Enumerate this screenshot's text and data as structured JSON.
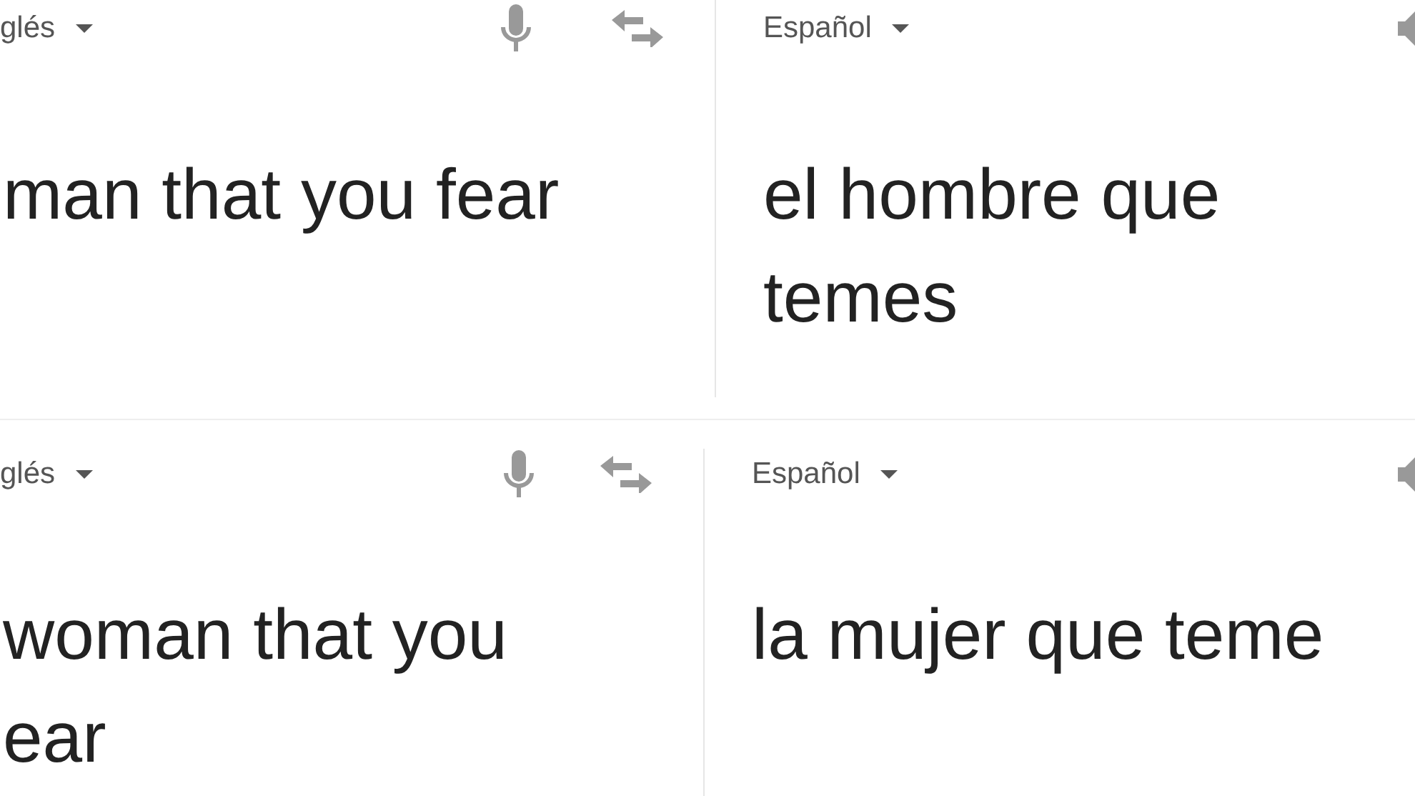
{
  "panels": [
    {
      "source": {
        "language": "glés",
        "text_lines": [
          "man that you fear"
        ]
      },
      "target": {
        "language": "Español",
        "text_lines": [
          "el hombre que",
          "temes"
        ]
      }
    },
    {
      "source": {
        "language": "glés",
        "text_lines": [
          "woman that you",
          "ear"
        ]
      },
      "target": {
        "language": "Español",
        "text_lines": [
          "la mujer que teme"
        ]
      }
    }
  ]
}
